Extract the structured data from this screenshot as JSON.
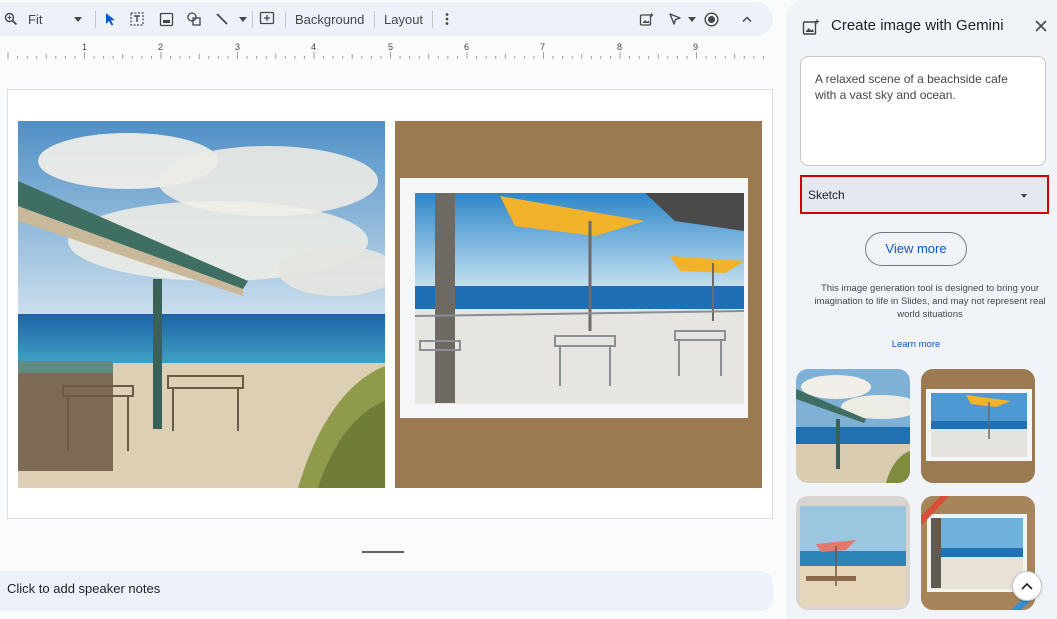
{
  "toolbar": {
    "zoom_label": "Fit",
    "background_label": "Background",
    "layout_label": "Layout"
  },
  "ruler": {
    "numbers": [
      "1",
      "2",
      "3",
      "4",
      "5",
      "6",
      "7",
      "8",
      "9"
    ]
  },
  "notes": {
    "placeholder": "Click to add speaker notes"
  },
  "side_panel": {
    "title": "Create image with Gemini",
    "prompt": "A relaxed scene of a beachside cafe with a vast sky and ocean.",
    "style_value": "Sketch",
    "view_more_label": "View more",
    "disclaimer": "This image generation tool is designed to bring your imagination to life in Slides, and may not represent real world situations",
    "learn_more_label": "Learn more"
  },
  "colors": {
    "accent": "#0b57d0",
    "highlight_border": "#d40000",
    "panel_bg": "#f0f4f9",
    "toolbar_bg": "#edf2fa"
  },
  "icons": {
    "zoom": "zoom-icon",
    "select": "cursor-icon",
    "text_box": "text-box-icon",
    "image": "image-icon",
    "shape": "shape-icon",
    "line": "line-icon",
    "comment": "add-comment-icon",
    "more": "more-vertical-icon",
    "gemini_image": "gemini-image-icon",
    "pen": "pen-icon",
    "record": "record-icon",
    "collapse": "chevron-up-icon",
    "close": "close-icon"
  }
}
